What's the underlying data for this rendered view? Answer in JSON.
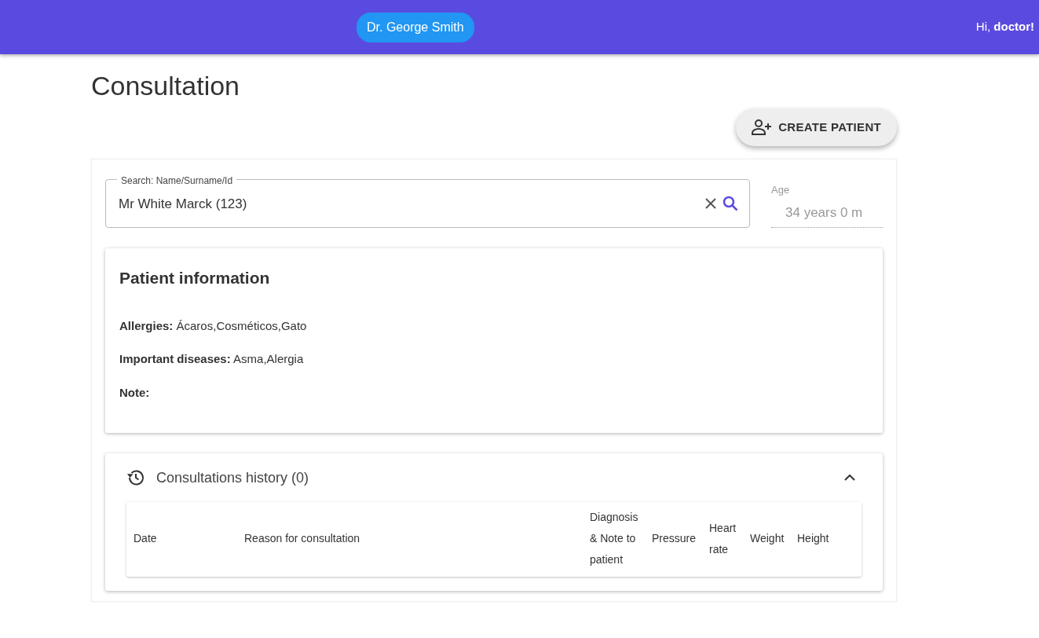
{
  "header": {
    "doctor": "Dr. George Smith",
    "greeting": "Hi, **doctor!**"
  },
  "page_title": "Consultation",
  "create_button": "CREATE PATIENT",
  "search": {
    "label": "Search: Name/Surname/Id",
    "value": "Mr White Marck (123)"
  },
  "age": {
    "label": "Age",
    "value": "34 years 0 m"
  },
  "patient_info": {
    "title": "Patient information",
    "fields": [
      {
        "label": "Allergies:",
        "value": "Ácaros,Cosméticos,Gato"
      },
      {
        "label": "Important diseases:",
        "value": "Asma,Alergia"
      },
      {
        "label": "Note:"
      }
    ]
  },
  "history": {
    "title": "Consultations history (0)",
    "expanded": true,
    "columns": [
      "Date",
      "Reason for consultation",
      "Diagnosis & Note to patient",
      "Pressure",
      "Heart rate",
      "Weight",
      "Height"
    ]
  }
}
